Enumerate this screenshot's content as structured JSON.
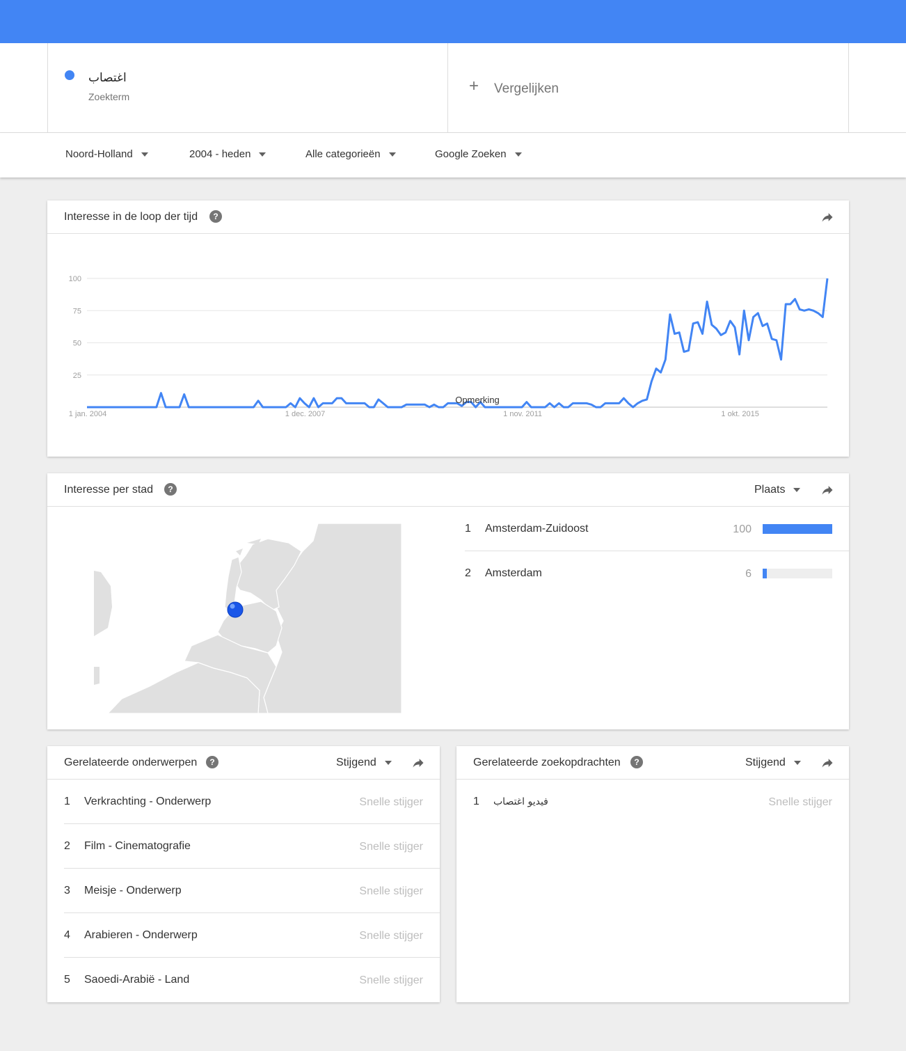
{
  "search_term": {
    "name": "اغتصاب",
    "type_label": "Zoekterm",
    "color": "#4285f4"
  },
  "compare": {
    "label": "Vergelijken"
  },
  "filters": {
    "region": "Noord-Holland",
    "period": "2004 - heden",
    "category": "Alle categorieën",
    "property": "Google Zoeken"
  },
  "interest_over_time": {
    "title": "Interesse in de loop der tijd",
    "note_label": "Opmerking",
    "chart_data": {
      "type": "line",
      "title": "",
      "xlabel": "",
      "ylabel": "",
      "ylim": [
        0,
        100
      ],
      "yticks": [
        25,
        50,
        75,
        100
      ],
      "x_tick_labels": [
        "1 jan. 2004",
        "1 dec. 2007",
        "1 nov. 2011",
        "1 okt. 2015"
      ],
      "x_tick_index": [
        0,
        47,
        94,
        141
      ],
      "grid": true,
      "color": "#4285f4",
      "series": [
        {
          "values": [
            0,
            0,
            0,
            0,
            0,
            0,
            0,
            0,
            0,
            0,
            0,
            0,
            0,
            0,
            0,
            0,
            11,
            0,
            0,
            0,
            0,
            10,
            0,
            0,
            0,
            0,
            0,
            0,
            0,
            0,
            0,
            0,
            0,
            0,
            0,
            0,
            0,
            5,
            0,
            0,
            0,
            0,
            0,
            0,
            3,
            0,
            7,
            3,
            0,
            7,
            0,
            3,
            3,
            3,
            7,
            7,
            3,
            3,
            3,
            3,
            3,
            0,
            0,
            6,
            3,
            0,
            0,
            0,
            0,
            2,
            2,
            2,
            2,
            2,
            0,
            2,
            0,
            0,
            3,
            3,
            3,
            1,
            4,
            4,
            0,
            4,
            0,
            0,
            0,
            0,
            0,
            0,
            0,
            0,
            0,
            4,
            0,
            0,
            0,
            0,
            3,
            0,
            3,
            0,
            0,
            3,
            3,
            3,
            3,
            2,
            0,
            0,
            3,
            3,
            3,
            3,
            7,
            3,
            0,
            3,
            5,
            6,
            20,
            30,
            27,
            37,
            72,
            57,
            58,
            43,
            44,
            65,
            66,
            57,
            82,
            64,
            61,
            56,
            58,
            67,
            62,
            41,
            75,
            52,
            70,
            73,
            63,
            65,
            53,
            52,
            37,
            80,
            80,
            84,
            76,
            75,
            76,
            75,
            73,
            70,
            100
          ]
        }
      ]
    }
  },
  "interest_by_city": {
    "title": "Interesse per stad",
    "dropdown": "Plaats",
    "rows": [
      {
        "rank": "1",
        "name": "Amsterdam-Zuidoost",
        "value": 100
      },
      {
        "rank": "2",
        "name": "Amsterdam",
        "value": 6
      }
    ]
  },
  "related_topics": {
    "title": "Gerelateerde onderwerpen",
    "dropdown": "Stijgend",
    "rows": [
      {
        "rank": "1",
        "name": "Verkrachting - Onderwerp",
        "status": "Snelle stijger"
      },
      {
        "rank": "2",
        "name": "Film - Cinematografie",
        "status": "Snelle stijger"
      },
      {
        "rank": "3",
        "name": "Meisje - Onderwerp",
        "status": "Snelle stijger"
      },
      {
        "rank": "4",
        "name": "Arabieren - Onderwerp",
        "status": "Snelle stijger"
      },
      {
        "rank": "5",
        "name": "Saoedi-Arabië - Land",
        "status": "Snelle stijger"
      }
    ]
  },
  "related_queries": {
    "title": "Gerelateerde zoekopdrachten",
    "dropdown": "Stijgend",
    "rows": [
      {
        "rank": "1",
        "name": "فيديو اغتصاب",
        "status": "Snelle stijger"
      }
    ]
  },
  "icons": {
    "help": "help-icon",
    "share": "share-icon",
    "add": "plus-icon",
    "dropdown": "caret-down-icon"
  }
}
